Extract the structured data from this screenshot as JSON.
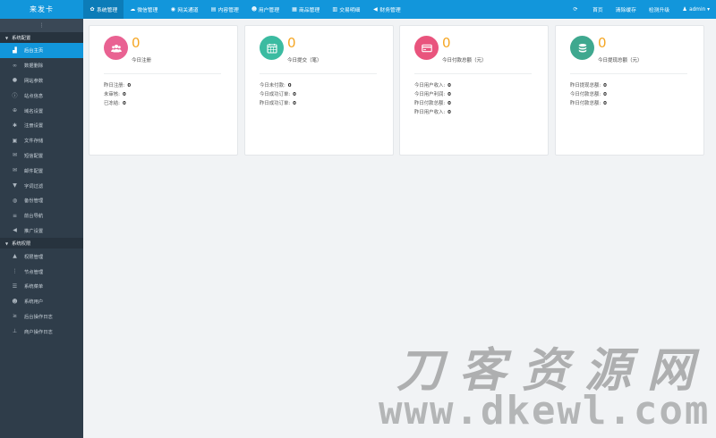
{
  "brand": "来发卡",
  "nav": [
    {
      "label": "系统管理",
      "icon": "gear-icon",
      "glyph": "✿",
      "active": true
    },
    {
      "label": "微信管理",
      "icon": "chat-icon",
      "glyph": "☁",
      "active": false
    },
    {
      "label": "网关通道",
      "icon": "globe-icon",
      "glyph": "◉",
      "active": false
    },
    {
      "label": "内容管理",
      "icon": "document-icon",
      "glyph": "▤",
      "active": false
    },
    {
      "label": "用户管理",
      "icon": "users-icon",
      "glyph": "☻",
      "active": false
    },
    {
      "label": "商品管理",
      "icon": "store-icon",
      "glyph": "▦",
      "active": false
    },
    {
      "label": "交易明细",
      "icon": "chart-icon",
      "glyph": "▥",
      "active": false
    },
    {
      "label": "财务管理",
      "icon": "megaphone-icon",
      "glyph": "◀",
      "active": false
    }
  ],
  "topright": [
    {
      "label": "",
      "icon": "refresh-icon",
      "glyph": "⟳"
    },
    {
      "label": "首页",
      "icon": "",
      "glyph": ""
    },
    {
      "label": "清除缓存",
      "icon": "",
      "glyph": ""
    },
    {
      "label": "检测升级",
      "icon": "",
      "glyph": ""
    },
    {
      "label": "admin ▾",
      "icon": "user-icon",
      "glyph": "♟"
    }
  ],
  "sidebar": {
    "collapse_glyph": "⋮",
    "groups": [
      {
        "title": "系统配置",
        "items": [
          {
            "label": "后台主页",
            "icon": "bar-chart-icon",
            "glyph": "▟",
            "active": true
          },
          {
            "label": "数据删除",
            "icon": "link-icon",
            "glyph": "∞",
            "active": false
          },
          {
            "label": "网站参数",
            "icon": "apple-icon",
            "glyph": "●",
            "active": false
          },
          {
            "label": "站点信息",
            "icon": "info-icon",
            "glyph": "ⓘ",
            "active": false
          },
          {
            "label": "域名设置",
            "icon": "settings-icon",
            "glyph": "⊕",
            "active": false
          },
          {
            "label": "注册设置",
            "icon": "gear-icon",
            "glyph": "✱",
            "active": false
          },
          {
            "label": "文件存储",
            "icon": "save-icon",
            "glyph": "▣",
            "active": false
          },
          {
            "label": "短信配置",
            "icon": "mail-icon",
            "glyph": "✉",
            "active": false
          },
          {
            "label": "邮件配置",
            "icon": "envelope-icon",
            "glyph": "✉",
            "active": false
          },
          {
            "label": "字词过滤",
            "icon": "filter-icon",
            "glyph": "▼",
            "active": false
          },
          {
            "label": "备份管理",
            "icon": "database-icon",
            "glyph": "◍",
            "active": false
          },
          {
            "label": "前台导航",
            "icon": "list-icon",
            "glyph": "≡",
            "active": false
          },
          {
            "label": "推广设置",
            "icon": "megaphone-icon",
            "glyph": "◀",
            "active": false
          }
        ]
      },
      {
        "title": "系统权限",
        "items": [
          {
            "label": "权限管理",
            "icon": "lock-icon",
            "glyph": "▲",
            "active": false
          },
          {
            "label": "节点管理",
            "icon": "node-icon",
            "glyph": "⋮",
            "active": false
          },
          {
            "label": "系统菜单",
            "icon": "menu-icon",
            "glyph": "☰",
            "active": false
          },
          {
            "label": "系统用户",
            "icon": "users-icon",
            "glyph": "☻",
            "active": false
          },
          {
            "label": "后台操作日志",
            "icon": "terminal-icon",
            "glyph": "≥",
            "active": false
          },
          {
            "label": "商户操作日志",
            "icon": "pin-icon",
            "glyph": "⊥",
            "active": false
          }
        ]
      }
    ]
  },
  "cards": [
    {
      "number": "0",
      "title": "今日注册",
      "color": "#e96292",
      "icon": "users-icon",
      "stats": [
        {
          "label": "昨日注册:",
          "value": "0"
        },
        {
          "label": "未审核:",
          "value": "0"
        },
        {
          "label": "已冻结:",
          "value": "0"
        }
      ]
    },
    {
      "number": "0",
      "title": "今日提交（笔）",
      "color": "#3bbba1",
      "icon": "calendar-icon",
      "stats": [
        {
          "label": "今日未付款:",
          "value": "0"
        },
        {
          "label": "今日成功订单:",
          "value": "0"
        },
        {
          "label": "昨日成功订单:",
          "value": "0"
        }
      ]
    },
    {
      "number": "0",
      "title": "今日付款总额（元）",
      "color": "#e9547d",
      "icon": "credit-card-icon",
      "stats": [
        {
          "label": "今日用户收入:",
          "value": "0"
        },
        {
          "label": "今日用户利润:",
          "value": "0"
        },
        {
          "label": "昨日付款总额:",
          "value": "0"
        },
        {
          "label": "昨日用户收入:",
          "value": "0"
        }
      ]
    },
    {
      "number": "0",
      "title": "今日提现总额（元）",
      "color": "#3fa88f",
      "icon": "database-icon",
      "stats": [
        {
          "label": "昨日提现总额:",
          "value": "0"
        },
        {
          "label": "今日付款总额:",
          "value": "0"
        },
        {
          "label": "昨日付款总额:",
          "value": "0"
        }
      ]
    }
  ],
  "watermark": {
    "cn": "刀客资源网",
    "en": "www.dkewl.com"
  }
}
